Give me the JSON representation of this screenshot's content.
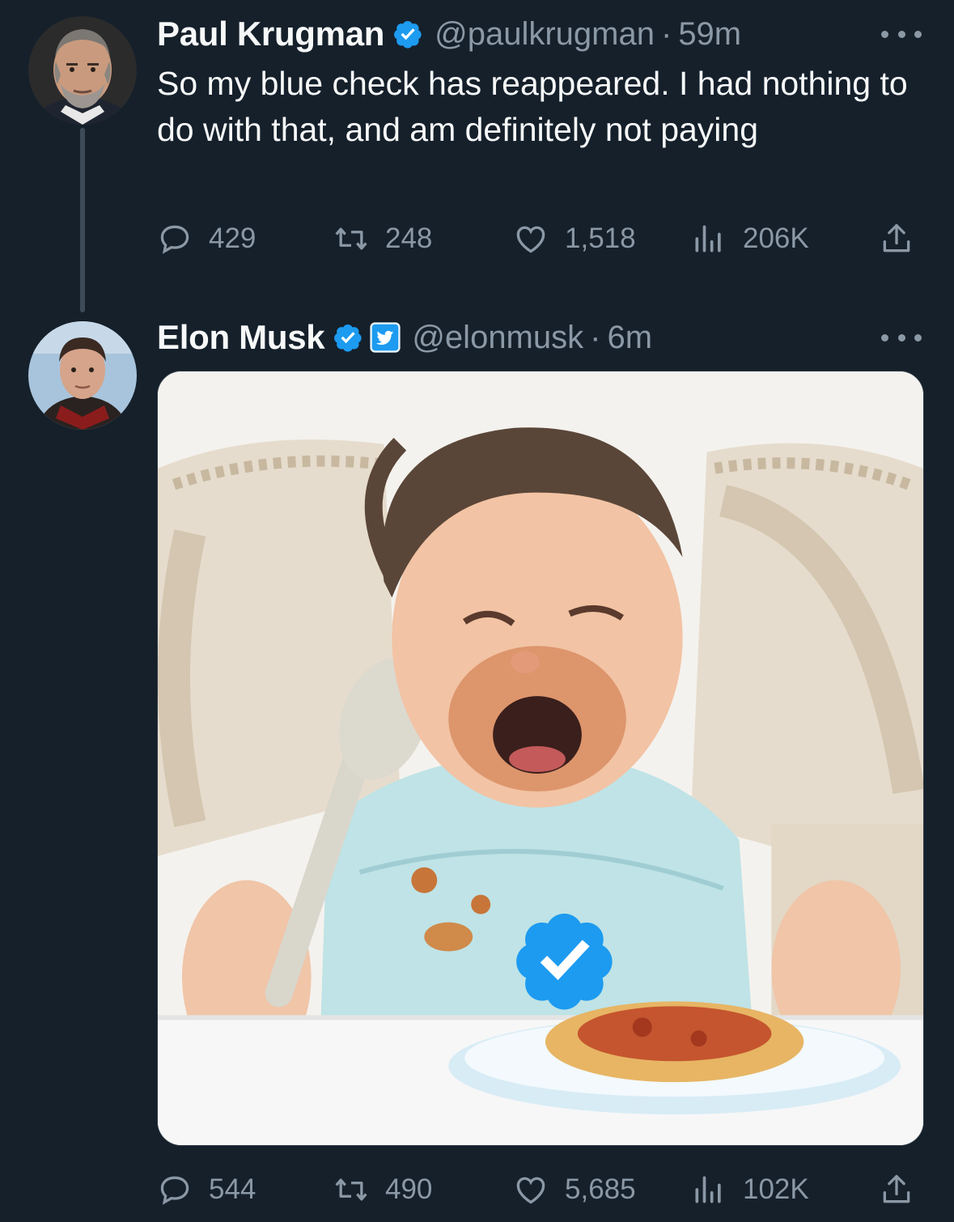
{
  "tweets": [
    {
      "display_name": "Paul Krugman",
      "handle": "@paulkrugman",
      "separator": "·",
      "time": "59m",
      "text": "So my blue check has reappeared. I had nothing to do with that, and am definitely not paying",
      "verified": true,
      "actions": {
        "replies": "429",
        "retweets": "248",
        "likes": "1,518",
        "views": "206K"
      }
    },
    {
      "display_name": "Elon Musk",
      "handle": "@elonmusk",
      "separator": "·",
      "time": "6m",
      "verified": true,
      "affiliate_badge": "twitter-bird-icon",
      "media": "crying toddler in high chair with spaghetti and blue verified checkmark",
      "actions": {
        "replies": "544",
        "retweets": "490",
        "likes": "5,685",
        "views": "102K"
      }
    }
  ],
  "colors": {
    "background": "#15202b",
    "text_primary": "#f7f9f9",
    "text_secondary": "#8b98a5",
    "verified_blue": "#1d9bf0",
    "thread_line": "#3d4b59"
  }
}
